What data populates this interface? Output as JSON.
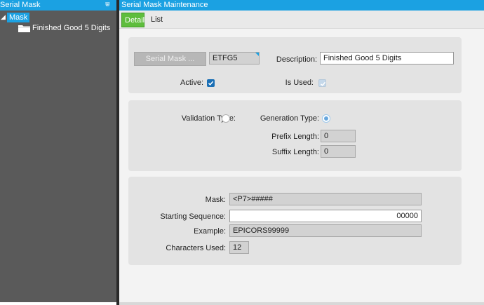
{
  "left_panel": {
    "title": "Serial Mask",
    "pin_glyph": "⩐",
    "tree": {
      "root_label": "Mask",
      "root_arrow": "◢",
      "children": [
        {
          "label": "Finished Good 5 Digits",
          "icon": "folder-icon"
        }
      ]
    }
  },
  "right_panel": {
    "title": "Serial Mask Maintenance",
    "tabs": [
      {
        "label": "Detail",
        "active": true
      },
      {
        "label": "List",
        "active": false
      }
    ]
  },
  "form": {
    "serial_mask_button": "Serial Mask ...",
    "serial_mask_value": "ETFG5",
    "description_label": "Description:",
    "description_value": "Finished Good 5 Digits",
    "active_label": "Active:",
    "active_checked": true,
    "is_used_label": "Is Used:",
    "is_used_checked": true,
    "validation_type_label": "Validation Type:",
    "validation_type_selected": false,
    "generation_type_label": "Generation Type:",
    "generation_type_selected": true,
    "prefix_length_label": "Prefix Length:",
    "prefix_length_value": "0",
    "suffix_length_label": "Suffix Length:",
    "suffix_length_value": "0",
    "mask_label": "Mask:",
    "mask_value": "<P7>#####",
    "starting_sequence_label": "Starting Sequence:",
    "starting_sequence_value": "00000",
    "example_label": "Example:",
    "example_value": "EPICORS99999",
    "characters_used_label": "Characters Used:",
    "characters_used_value": "12"
  },
  "colors": {
    "header_blue": "#1ba1e2",
    "active_tab_green": "#5ebd3d",
    "checkbox_blue": "#1a6fb5",
    "tree_background": "#5a5a5a"
  }
}
